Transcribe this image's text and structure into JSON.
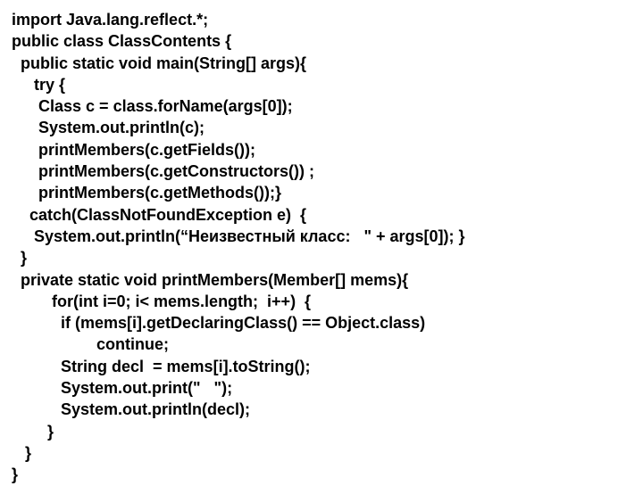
{
  "code": {
    "l1": " import Java.lang.reflect.*;",
    "l2": " public class ClassContents {",
    "l3": "   public static void main(String[] args){",
    "l4": "      try {",
    "l5": "       Class c = class.forName(args[0]);",
    "l6": "       System.out.println(c);",
    "l7": "       printMembers(c.getFields());",
    "l8": "       printMembers(c.getConstructors()) ;",
    "l9": "       printMembers(c.getMethods());}",
    "l10": "     catch(ClassNotFoundException e)  {",
    "l11": "      System.out.println(“Неизвестный класс:   \" + args[0]); }",
    "l12": "   }",
    "l13": "   private static void printMembers(Member[] mems){",
    "l14": "          for(int i=0; i< mems.length;  i++)  {",
    "l15": "            if (mems[i].getDeclaringClass() == Object.class)",
    "l16": "                    continue;",
    "l17": "            String decl  = mems[i].toString();",
    "l18": "            System.out.print(\"   \");",
    "l19": "            System.out.println(decl);",
    "l20": "         }",
    "l21": "    }",
    "l22": " }"
  }
}
